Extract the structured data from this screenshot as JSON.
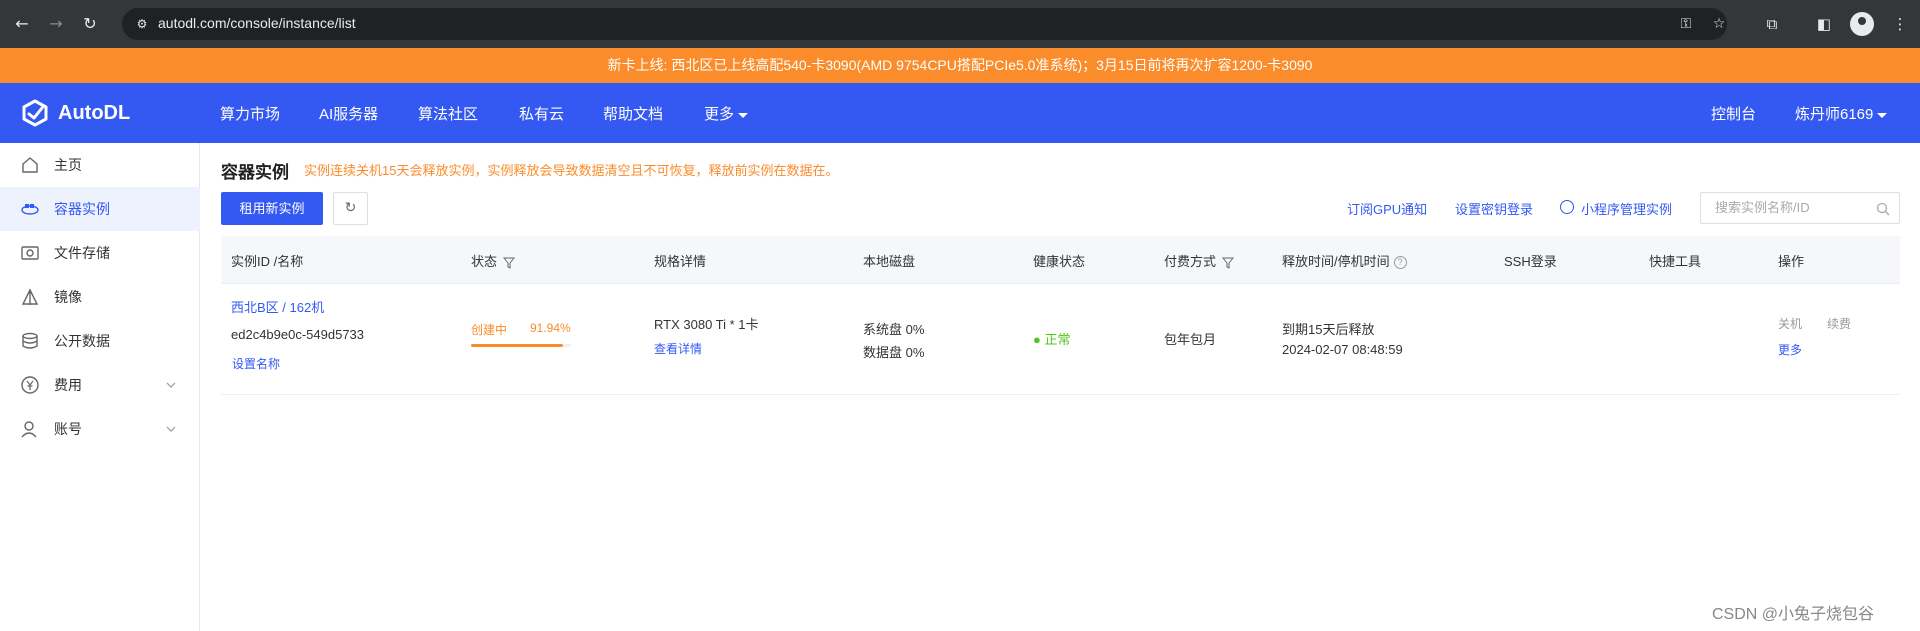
{
  "browser": {
    "url": "autodl.com/console/instance/list"
  },
  "announcement": "新卡上线: 西北区已上线高配540-卡3090(AMD 9754CPU搭配PCIe5.0准系统)；3月15日前将再次扩容1200-卡3090",
  "topnav": {
    "brand": "AutoDL",
    "items": [
      "算力市场",
      "AI服务器",
      "算法社区",
      "私有云",
      "帮助文档",
      "更多"
    ],
    "console": "控制台",
    "user": "炼丹师6169"
  },
  "sidebar": {
    "items": [
      {
        "label": "主页",
        "icon": "home-icon"
      },
      {
        "label": "容器实例",
        "icon": "container-icon"
      },
      {
        "label": "文件存储",
        "icon": "storage-icon"
      },
      {
        "label": "镜像",
        "icon": "image-icon"
      },
      {
        "label": "公开数据",
        "icon": "database-icon"
      },
      {
        "label": "费用",
        "icon": "yen-icon"
      },
      {
        "label": "账号",
        "icon": "user-icon"
      }
    ],
    "active_index": 1
  },
  "main": {
    "title": "容器实例",
    "warning": "实例连续关机15天会释放实例，实例释放会导致数据清空且不可恢复，释放前实例在数据在。",
    "rent_button": "租用新实例",
    "links": {
      "gpu_notify": "订阅GPU通知",
      "ssh_key": "设置密钥登录",
      "mini_program": "小程序管理实例"
    },
    "search_placeholder": "搜索实例名称/ID"
  },
  "table": {
    "headers": [
      "实例ID /名称",
      "状态",
      "规格详情",
      "本地磁盘",
      "健康状态",
      "付费方式",
      "释放时间/停机时间",
      "SSH登录",
      "快捷工具",
      "操作"
    ],
    "rows": [
      {
        "region_name": "西北B区 / 162机",
        "instance_id": "ed2c4b9e0c-549d5733",
        "set_name": "设置名称",
        "status": "创建中",
        "status_percent": "91.94%",
        "progress": 0.9194,
        "spec": "RTX 3080 Ti * 1卡",
        "spec_link": "查看详情",
        "disk_system": "系统盘 0%",
        "disk_data": "数据盘 0%",
        "health": "● 正常",
        "billing": "包年包月",
        "release_note": "到期15天后释放",
        "release_time": "2024-02-07 08:48:59",
        "actions": {
          "shutdown": "关机",
          "renew": "续费",
          "more": "更多"
        }
      }
    ]
  },
  "watermark": "CSDN @小兔子烧包谷"
}
